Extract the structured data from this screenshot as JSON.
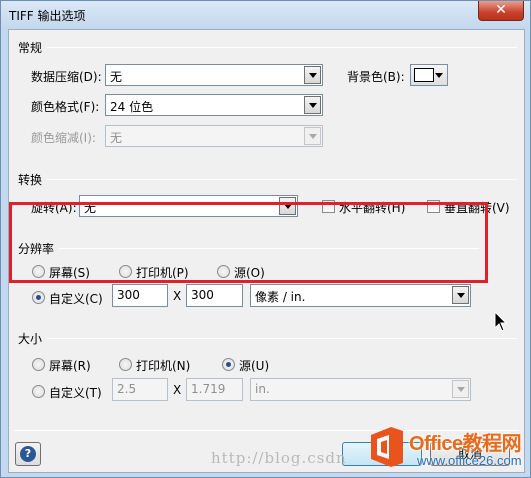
{
  "window": {
    "title": "TIFF 输出选项",
    "close_label": "✕"
  },
  "general": {
    "section_title": "常规",
    "compression_label": "数据压缩(D):",
    "compression_value": "无",
    "color_format_label": "颜色格式(F):",
    "color_format_value": "24 位色",
    "color_compression_label": "颜色缩减(I):",
    "color_compression_value": "无",
    "background_label": "背景色(B):",
    "background_color": "#ffffff"
  },
  "transform": {
    "section_title": "转换",
    "rotate_label": "旋转(A):",
    "rotate_value": "无",
    "flip_h_label": "水平翻转(H)",
    "flip_v_label": "垂直翻转(V)"
  },
  "resolution": {
    "section_title": "分辨率",
    "screen_label": "屏幕(S)",
    "printer_label": "打印机(P)",
    "source_label": "源(O)",
    "custom_label": "自定义(C)",
    "x_value": "300",
    "times": "X",
    "y_value": "300",
    "unit_value": "像素 / in.",
    "selected": "custom",
    "highlight_color": "#e0202a"
  },
  "size": {
    "section_title": "大小",
    "screen_label": "屏幕(R)",
    "printer_label": "打印机(N)",
    "source_label": "源(U)",
    "custom_label": "自定义(T)",
    "width_value": "2.5",
    "times": "X",
    "height_value": "1.719",
    "unit_value": "in.",
    "selected": "source"
  },
  "footer": {
    "help_label": "?",
    "cancel_label": "取消"
  },
  "overlay": {
    "watermark": "http://blog.csdn",
    "brand": "Office教程网",
    "site": "www.office26.com"
  }
}
